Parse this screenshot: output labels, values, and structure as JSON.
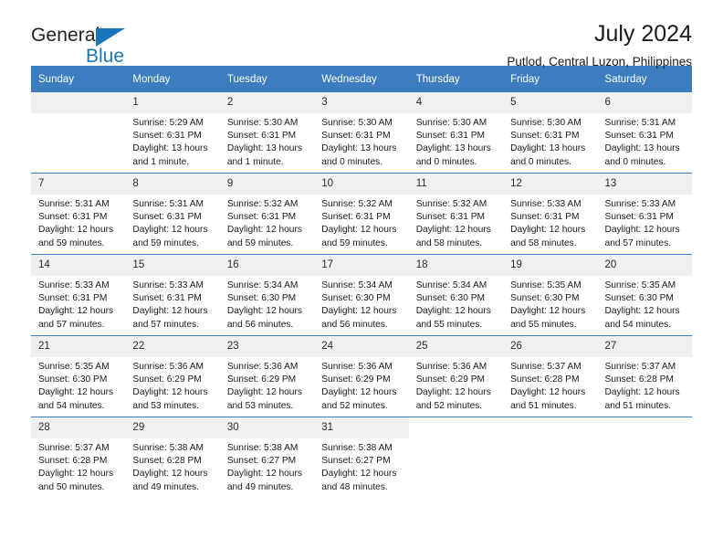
{
  "brand": {
    "name_part1": "General",
    "name_part2": "Blue",
    "triangle_color": "#1b75bb"
  },
  "header": {
    "title": "July 2024",
    "subtitle": "Putlod, Central Luzon, Philippines",
    "accent_color": "#3b7dbf",
    "day_band_color": "#f0f0f0"
  },
  "weekdays": [
    "Sunday",
    "Monday",
    "Tuesday",
    "Wednesday",
    "Thursday",
    "Friday",
    "Saturday"
  ],
  "weeks": [
    [
      {
        "day": "",
        "sunrise": "",
        "sunset": "",
        "daylight_line1": "",
        "daylight_line2": "",
        "empty": true
      },
      {
        "day": "1",
        "sunrise": "Sunrise: 5:29 AM",
        "sunset": "Sunset: 6:31 PM",
        "daylight_line1": "Daylight: 13 hours",
        "daylight_line2": "and 1 minute."
      },
      {
        "day": "2",
        "sunrise": "Sunrise: 5:30 AM",
        "sunset": "Sunset: 6:31 PM",
        "daylight_line1": "Daylight: 13 hours",
        "daylight_line2": "and 1 minute."
      },
      {
        "day": "3",
        "sunrise": "Sunrise: 5:30 AM",
        "sunset": "Sunset: 6:31 PM",
        "daylight_line1": "Daylight: 13 hours",
        "daylight_line2": "and 0 minutes."
      },
      {
        "day": "4",
        "sunrise": "Sunrise: 5:30 AM",
        "sunset": "Sunset: 6:31 PM",
        "daylight_line1": "Daylight: 13 hours",
        "daylight_line2": "and 0 minutes."
      },
      {
        "day": "5",
        "sunrise": "Sunrise: 5:30 AM",
        "sunset": "Sunset: 6:31 PM",
        "daylight_line1": "Daylight: 13 hours",
        "daylight_line2": "and 0 minutes."
      },
      {
        "day": "6",
        "sunrise": "Sunrise: 5:31 AM",
        "sunset": "Sunset: 6:31 PM",
        "daylight_line1": "Daylight: 13 hours",
        "daylight_line2": "and 0 minutes."
      }
    ],
    [
      {
        "day": "7",
        "sunrise": "Sunrise: 5:31 AM",
        "sunset": "Sunset: 6:31 PM",
        "daylight_line1": "Daylight: 12 hours",
        "daylight_line2": "and 59 minutes."
      },
      {
        "day": "8",
        "sunrise": "Sunrise: 5:31 AM",
        "sunset": "Sunset: 6:31 PM",
        "daylight_line1": "Daylight: 12 hours",
        "daylight_line2": "and 59 minutes."
      },
      {
        "day": "9",
        "sunrise": "Sunrise: 5:32 AM",
        "sunset": "Sunset: 6:31 PM",
        "daylight_line1": "Daylight: 12 hours",
        "daylight_line2": "and 59 minutes."
      },
      {
        "day": "10",
        "sunrise": "Sunrise: 5:32 AM",
        "sunset": "Sunset: 6:31 PM",
        "daylight_line1": "Daylight: 12 hours",
        "daylight_line2": "and 59 minutes."
      },
      {
        "day": "11",
        "sunrise": "Sunrise: 5:32 AM",
        "sunset": "Sunset: 6:31 PM",
        "daylight_line1": "Daylight: 12 hours",
        "daylight_line2": "and 58 minutes."
      },
      {
        "day": "12",
        "sunrise": "Sunrise: 5:33 AM",
        "sunset": "Sunset: 6:31 PM",
        "daylight_line1": "Daylight: 12 hours",
        "daylight_line2": "and 58 minutes."
      },
      {
        "day": "13",
        "sunrise": "Sunrise: 5:33 AM",
        "sunset": "Sunset: 6:31 PM",
        "daylight_line1": "Daylight: 12 hours",
        "daylight_line2": "and 57 minutes."
      }
    ],
    [
      {
        "day": "14",
        "sunrise": "Sunrise: 5:33 AM",
        "sunset": "Sunset: 6:31 PM",
        "daylight_line1": "Daylight: 12 hours",
        "daylight_line2": "and 57 minutes."
      },
      {
        "day": "15",
        "sunrise": "Sunrise: 5:33 AM",
        "sunset": "Sunset: 6:31 PM",
        "daylight_line1": "Daylight: 12 hours",
        "daylight_line2": "and 57 minutes."
      },
      {
        "day": "16",
        "sunrise": "Sunrise: 5:34 AM",
        "sunset": "Sunset: 6:30 PM",
        "daylight_line1": "Daylight: 12 hours",
        "daylight_line2": "and 56 minutes."
      },
      {
        "day": "17",
        "sunrise": "Sunrise: 5:34 AM",
        "sunset": "Sunset: 6:30 PM",
        "daylight_line1": "Daylight: 12 hours",
        "daylight_line2": "and 56 minutes."
      },
      {
        "day": "18",
        "sunrise": "Sunrise: 5:34 AM",
        "sunset": "Sunset: 6:30 PM",
        "daylight_line1": "Daylight: 12 hours",
        "daylight_line2": "and 55 minutes."
      },
      {
        "day": "19",
        "sunrise": "Sunrise: 5:35 AM",
        "sunset": "Sunset: 6:30 PM",
        "daylight_line1": "Daylight: 12 hours",
        "daylight_line2": "and 55 minutes."
      },
      {
        "day": "20",
        "sunrise": "Sunrise: 5:35 AM",
        "sunset": "Sunset: 6:30 PM",
        "daylight_line1": "Daylight: 12 hours",
        "daylight_line2": "and 54 minutes."
      }
    ],
    [
      {
        "day": "21",
        "sunrise": "Sunrise: 5:35 AM",
        "sunset": "Sunset: 6:30 PM",
        "daylight_line1": "Daylight: 12 hours",
        "daylight_line2": "and 54 minutes."
      },
      {
        "day": "22",
        "sunrise": "Sunrise: 5:36 AM",
        "sunset": "Sunset: 6:29 PM",
        "daylight_line1": "Daylight: 12 hours",
        "daylight_line2": "and 53 minutes."
      },
      {
        "day": "23",
        "sunrise": "Sunrise: 5:36 AM",
        "sunset": "Sunset: 6:29 PM",
        "daylight_line1": "Daylight: 12 hours",
        "daylight_line2": "and 53 minutes."
      },
      {
        "day": "24",
        "sunrise": "Sunrise: 5:36 AM",
        "sunset": "Sunset: 6:29 PM",
        "daylight_line1": "Daylight: 12 hours",
        "daylight_line2": "and 52 minutes."
      },
      {
        "day": "25",
        "sunrise": "Sunrise: 5:36 AM",
        "sunset": "Sunset: 6:29 PM",
        "daylight_line1": "Daylight: 12 hours",
        "daylight_line2": "and 52 minutes."
      },
      {
        "day": "26",
        "sunrise": "Sunrise: 5:37 AM",
        "sunset": "Sunset: 6:28 PM",
        "daylight_line1": "Daylight: 12 hours",
        "daylight_line2": "and 51 minutes."
      },
      {
        "day": "27",
        "sunrise": "Sunrise: 5:37 AM",
        "sunset": "Sunset: 6:28 PM",
        "daylight_line1": "Daylight: 12 hours",
        "daylight_line2": "and 51 minutes."
      }
    ],
    [
      {
        "day": "28",
        "sunrise": "Sunrise: 5:37 AM",
        "sunset": "Sunset: 6:28 PM",
        "daylight_line1": "Daylight: 12 hours",
        "daylight_line2": "and 50 minutes."
      },
      {
        "day": "29",
        "sunrise": "Sunrise: 5:38 AM",
        "sunset": "Sunset: 6:28 PM",
        "daylight_line1": "Daylight: 12 hours",
        "daylight_line2": "and 49 minutes."
      },
      {
        "day": "30",
        "sunrise": "Sunrise: 5:38 AM",
        "sunset": "Sunset: 6:27 PM",
        "daylight_line1": "Daylight: 12 hours",
        "daylight_line2": "and 49 minutes."
      },
      {
        "day": "31",
        "sunrise": "Sunrise: 5:38 AM",
        "sunset": "Sunset: 6:27 PM",
        "daylight_line1": "Daylight: 12 hours",
        "daylight_line2": "and 48 minutes."
      },
      {
        "day": "",
        "sunrise": "",
        "sunset": "",
        "daylight_line1": "",
        "daylight_line2": "",
        "empty": true,
        "blank": true
      },
      {
        "day": "",
        "sunrise": "",
        "sunset": "",
        "daylight_line1": "",
        "daylight_line2": "",
        "empty": true,
        "blank": true
      },
      {
        "day": "",
        "sunrise": "",
        "sunset": "",
        "daylight_line1": "",
        "daylight_line2": "",
        "empty": true,
        "blank": true
      }
    ]
  ]
}
